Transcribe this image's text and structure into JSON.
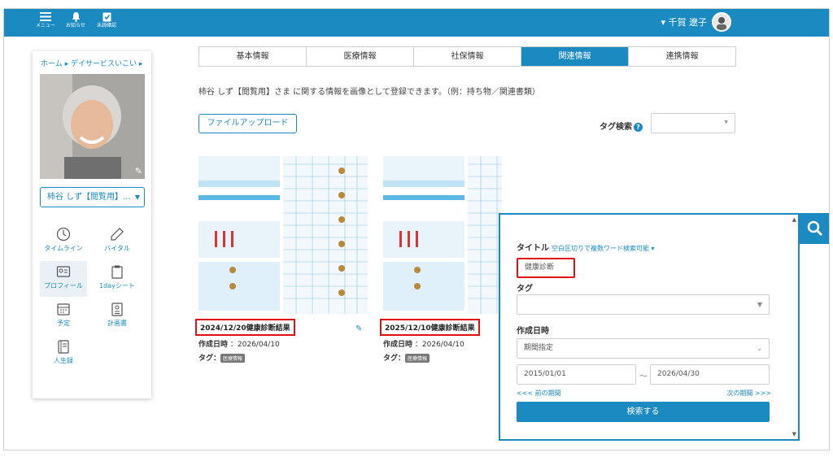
{
  "topbar": {
    "menu_label": "メニュー",
    "notice_label": "お知らせ",
    "unconfirmed_label": "未読確認",
    "user_name": "▾ 千賀 遼子"
  },
  "sidebar": {
    "breadcrumb": "ホーム ▸ デイサービスいこい ▸",
    "person_select": "柿谷 しず【閲覧用】...",
    "nav": [
      {
        "label": "タイムライン",
        "icon": "clock-icon"
      },
      {
        "label": "バイタル",
        "icon": "thermometer-icon"
      },
      {
        "label": "プロフィール",
        "icon": "profile-card-icon"
      },
      {
        "label": "1dayシート",
        "icon": "clipboard-icon"
      },
      {
        "label": "予定",
        "icon": "calendar-icon"
      },
      {
        "label": "計画書",
        "icon": "plan-document-icon"
      },
      {
        "label": "人生録",
        "icon": "book-icon"
      }
    ]
  },
  "tabs": [
    "基本情報",
    "医療情報",
    "社保情報",
    "関連情報",
    "連携情報"
  ],
  "active_tab": "関連情報",
  "description": "柿谷 しず【閲覧用】さま に関する情報を画像として登録できます。（例：持ち物／関連書類）",
  "upload_button": "ファイルアップロード",
  "tag_search_label": "タグ検索",
  "cards": [
    {
      "title": "2024/12/20健康診断結果",
      "created_label": "作成日時",
      "created": "：2026/04/10",
      "tag_label": "タグ：",
      "tag": "医療情報"
    },
    {
      "title": "2025/12/10健康診断結果",
      "created_label": "作成日時",
      "created": "：2026/04/10",
      "tag_label": "タグ：",
      "tag": "医療情報"
    }
  ],
  "search_panel": {
    "title_label": "タイトル",
    "title_hint": "空白区切りで複数ワード検索可能 ▾",
    "title_value": "健康診断",
    "tag_label": "タグ",
    "date_label": "作成日時",
    "period_select": "期間指定",
    "date_from": "2015/01/01",
    "date_sep": "〜",
    "date_to": "2026/04/30",
    "prev_link": "<<< 前の期間",
    "next_link": "次の期間 >>>",
    "submit": "検索する"
  },
  "colors": {
    "accent": "#1a8ac0",
    "highlight": "#e01010"
  }
}
